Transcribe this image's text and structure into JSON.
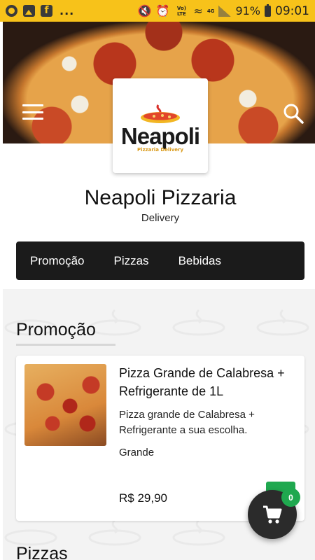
{
  "status_bar": {
    "icons_left": [
      "whatsapp-icon",
      "gallery-icon",
      "facebook-icon"
    ],
    "overflow": "...",
    "network_small": "Vo) LTE",
    "network_type": "4G",
    "battery": "91%",
    "time": "09:01"
  },
  "header": {
    "menu_icon": "hamburger-menu-icon",
    "search_icon": "search-icon"
  },
  "logo": {
    "brand": "Neapoli",
    "tagline": "Pizzaria Delivery"
  },
  "store": {
    "name": "Neapoli Pizzaria",
    "subtitle": "Delivery"
  },
  "categories": [
    {
      "label": "Promoção"
    },
    {
      "label": "Pizzas"
    },
    {
      "label": "Bebidas"
    }
  ],
  "sections": [
    {
      "title": "Promoção",
      "products": [
        {
          "name": "Pizza Grande de Calabresa + Refrigerante de 1L",
          "description": "Pizza grande de Calabresa + Refrigerante a sua escolha.",
          "size": "Grande",
          "price": "R$ 29,90"
        }
      ]
    },
    {
      "title": "Pizzas"
    }
  ],
  "cart": {
    "count": "0",
    "icon": "shopping-cart-icon"
  },
  "colors": {
    "status_bar": "#f7c21a",
    "tabs_bg": "#1b1b1b",
    "accent_green": "#1fa84f",
    "fab_bg": "#2b2b2b"
  }
}
